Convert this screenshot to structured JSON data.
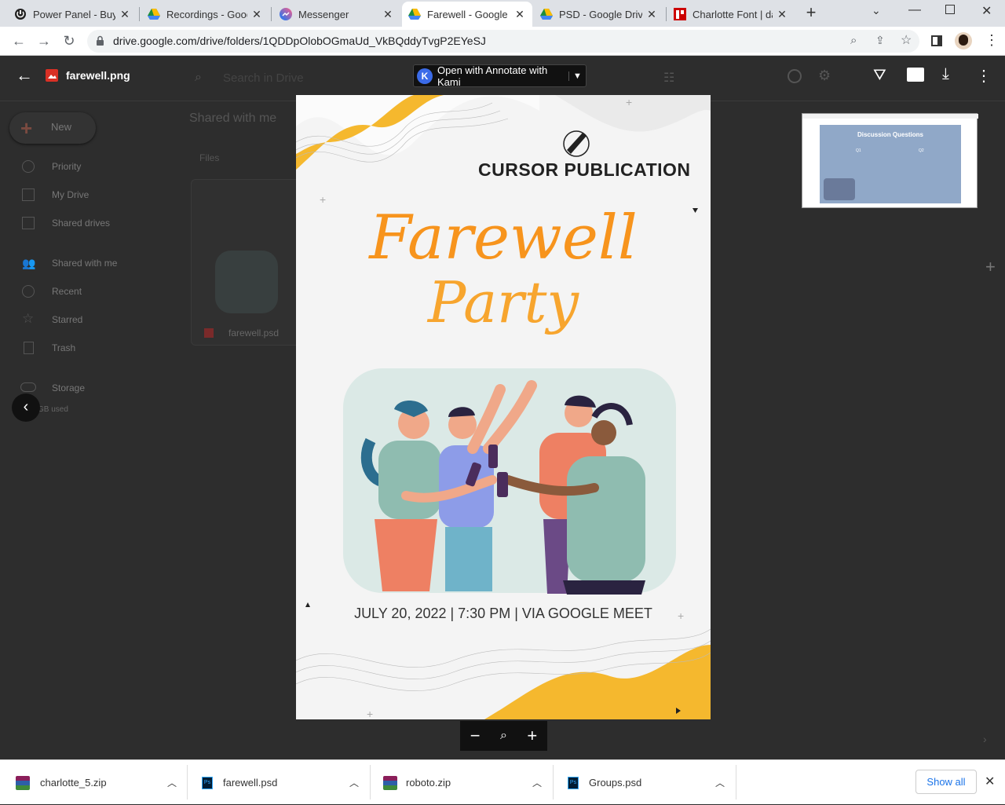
{
  "tabs": [
    {
      "title": "Power Panel - Buys",
      "favicon": "power-panel"
    },
    {
      "title": "Recordings - Goog",
      "favicon": "drive"
    },
    {
      "title": "Messenger",
      "favicon": "messenger"
    },
    {
      "title": "Farewell - Google D",
      "favicon": "drive",
      "active": true
    },
    {
      "title": "PSD - Google Drive",
      "favicon": "drive"
    },
    {
      "title": "Charlotte Font | daf",
      "favicon": "dafont"
    }
  ],
  "address": {
    "url": "drive.google.com/drive/folders/1QDDpOlobOGmaUd_VkBQddyTvgP2EYeSJ"
  },
  "drive": {
    "search_placeholder": "Search in Drive",
    "new_label": "New",
    "nav": [
      "Priority",
      "My Drive",
      "Shared drives",
      "Shared with me",
      "Recent",
      "Starred",
      "Trash",
      "Storage"
    ],
    "storage_used": "GB used",
    "breadcrumb": "Shared with me",
    "files_label": "Files",
    "file_name": "farewell.psd"
  },
  "viewer": {
    "file_name": "farewell.png",
    "open_with": "Open with Annotate with Kami"
  },
  "poster": {
    "publisher": "CURSOR PUBLICATION",
    "title_line1": "Farewell",
    "title_line2": "Party",
    "details": "JULY 20, 2022 | 7:30 PM | VIA GOOGLE MEET"
  },
  "thumbnail": {
    "title": "Discussion Questions",
    "q1": "Q1",
    "q2": "Q2"
  },
  "downloads": [
    {
      "name": "charlotte_5.zip",
      "icon": "zip"
    },
    {
      "name": "farewell.psd",
      "icon": "psd"
    },
    {
      "name": "roboto.zip",
      "icon": "zip"
    },
    {
      "name": "Groups.psd",
      "icon": "psd"
    }
  ],
  "download_bar": {
    "show_all": "Show all"
  },
  "colors": {
    "accent_orange": "#f7941d",
    "wave_yellow": "#f5b82e",
    "drive_blue": "#1a73e8"
  }
}
